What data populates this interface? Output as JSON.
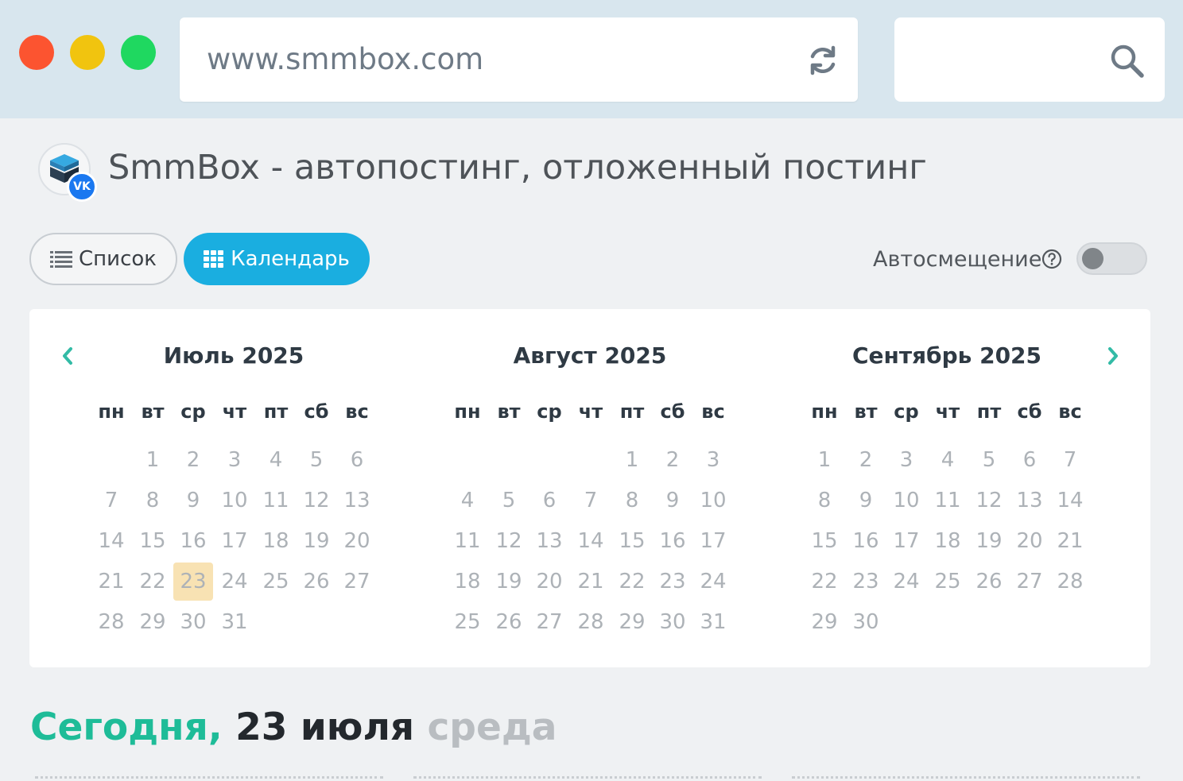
{
  "browser": {
    "url": "www.smmbox.com",
    "traffic_lights": [
      "#fc5430",
      "#f1c40f",
      "#1fd860"
    ],
    "reload_icon": "reload-icon",
    "search_icon": "search-icon"
  },
  "header": {
    "title": "SmmBox - автопостинг, отложенный постинг",
    "logo_badge": "VK"
  },
  "views": {
    "list_label": "Список",
    "calendar_label": "Календарь",
    "active": "calendar",
    "accent": "#1aaee0"
  },
  "auto_shift": {
    "label": "Автосмещение",
    "enabled": false
  },
  "calendar": {
    "weekdays": [
      "пн",
      "вт",
      "ср",
      "чт",
      "пт",
      "сб",
      "вс"
    ],
    "today_highlight": "#f8e2b3",
    "months": [
      {
        "title": "Июль 2025",
        "offset": 1,
        "days": 31,
        "today": 23
      },
      {
        "title": "Август 2025",
        "offset": 4,
        "days": 31,
        "today": null
      },
      {
        "title": "Сентябрь 2025",
        "offset": 0,
        "days": 30,
        "today": null
      }
    ]
  },
  "today": {
    "label": "Сегодня,",
    "date": "23 июля",
    "weekday": "среда",
    "colors": {
      "label": "#1ebc98",
      "date": "#23282d",
      "weekday": "#b9bdc1"
    }
  }
}
